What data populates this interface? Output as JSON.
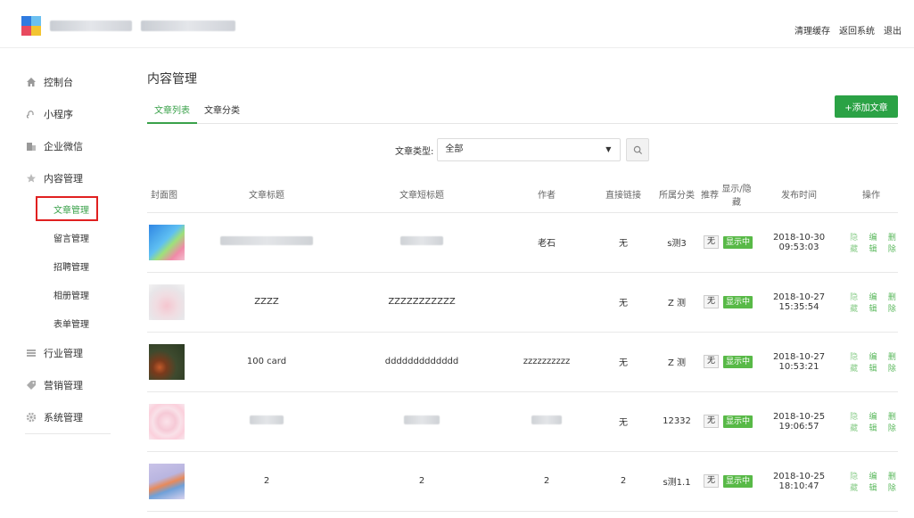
{
  "header": {
    "links": [
      "清理缓存",
      "返回系统",
      "退出"
    ]
  },
  "sidebar": {
    "items": [
      {
        "label": "控制台",
        "icon": "home-icon"
      },
      {
        "label": "小程序",
        "icon": "miniprogram-icon"
      },
      {
        "label": "企业微信",
        "icon": "building-icon"
      },
      {
        "label": "内容管理",
        "icon": "star-icon"
      }
    ],
    "subitems": [
      "文章管理",
      "留言管理",
      "招聘管理",
      "相册管理",
      "表单管理"
    ],
    "items_after": [
      {
        "label": "行业管理",
        "icon": "list-icon"
      },
      {
        "label": "营销管理",
        "icon": "tag-icon"
      },
      {
        "label": "系统管理",
        "icon": "gear-icon"
      }
    ]
  },
  "main": {
    "title": "内容管理",
    "tabs": [
      "文章列表",
      "文章分类"
    ],
    "add_button": "+添加文章",
    "filter": {
      "label": "文章类型:",
      "selected": "全部",
      "caret": "▼"
    }
  },
  "table": {
    "headers": [
      "封面图",
      "文章标题",
      "文章短标题",
      "作者",
      "直接链接",
      "所属分类",
      "推荐",
      "显示/隐藏",
      "发布时间",
      "操作"
    ],
    "rows": [
      {
        "title": "",
        "short_title": "",
        "author": "老石",
        "link": "无",
        "category": "s测3",
        "recommend": "无",
        "status": "显示中",
        "time": "2018-10-30 09:53:03",
        "toggle": "隐藏",
        "edit": "编辑",
        "delete": "删除"
      },
      {
        "title": "ZZZZ",
        "short_title": "ZZZZZZZZZZZ",
        "author": "",
        "link": "无",
        "category": "Z 测",
        "recommend": "无",
        "status": "显示中",
        "time": "2018-10-27 15:35:54",
        "toggle": "隐藏",
        "edit": "编辑",
        "delete": "删除"
      },
      {
        "title": "100 card",
        "short_title": "ddddddddddddd",
        "author": "zzzzzzzzzz",
        "link": "无",
        "category": "Z 测",
        "recommend": "无",
        "status": "显示中",
        "time": "2018-10-27 10:53:21",
        "toggle": "隐藏",
        "edit": "编辑",
        "delete": "删除"
      },
      {
        "title": "",
        "short_title": "",
        "author": "",
        "link": "无",
        "category": "12332",
        "recommend": "无",
        "status": "显示中",
        "time": "2018-10-25 19:06:57",
        "toggle": "隐藏",
        "edit": "编辑",
        "delete": "删除"
      },
      {
        "title": "2",
        "short_title": "2",
        "author": "2",
        "link": "2",
        "category": "s测1.1",
        "recommend": "无",
        "status": "显示中",
        "time": "2018-10-25 18:10:47",
        "toggle": "隐藏",
        "edit": "编辑",
        "delete": "删除"
      }
    ]
  },
  "colors": {
    "accent": "#2ba245",
    "highlight": "#e02020"
  }
}
